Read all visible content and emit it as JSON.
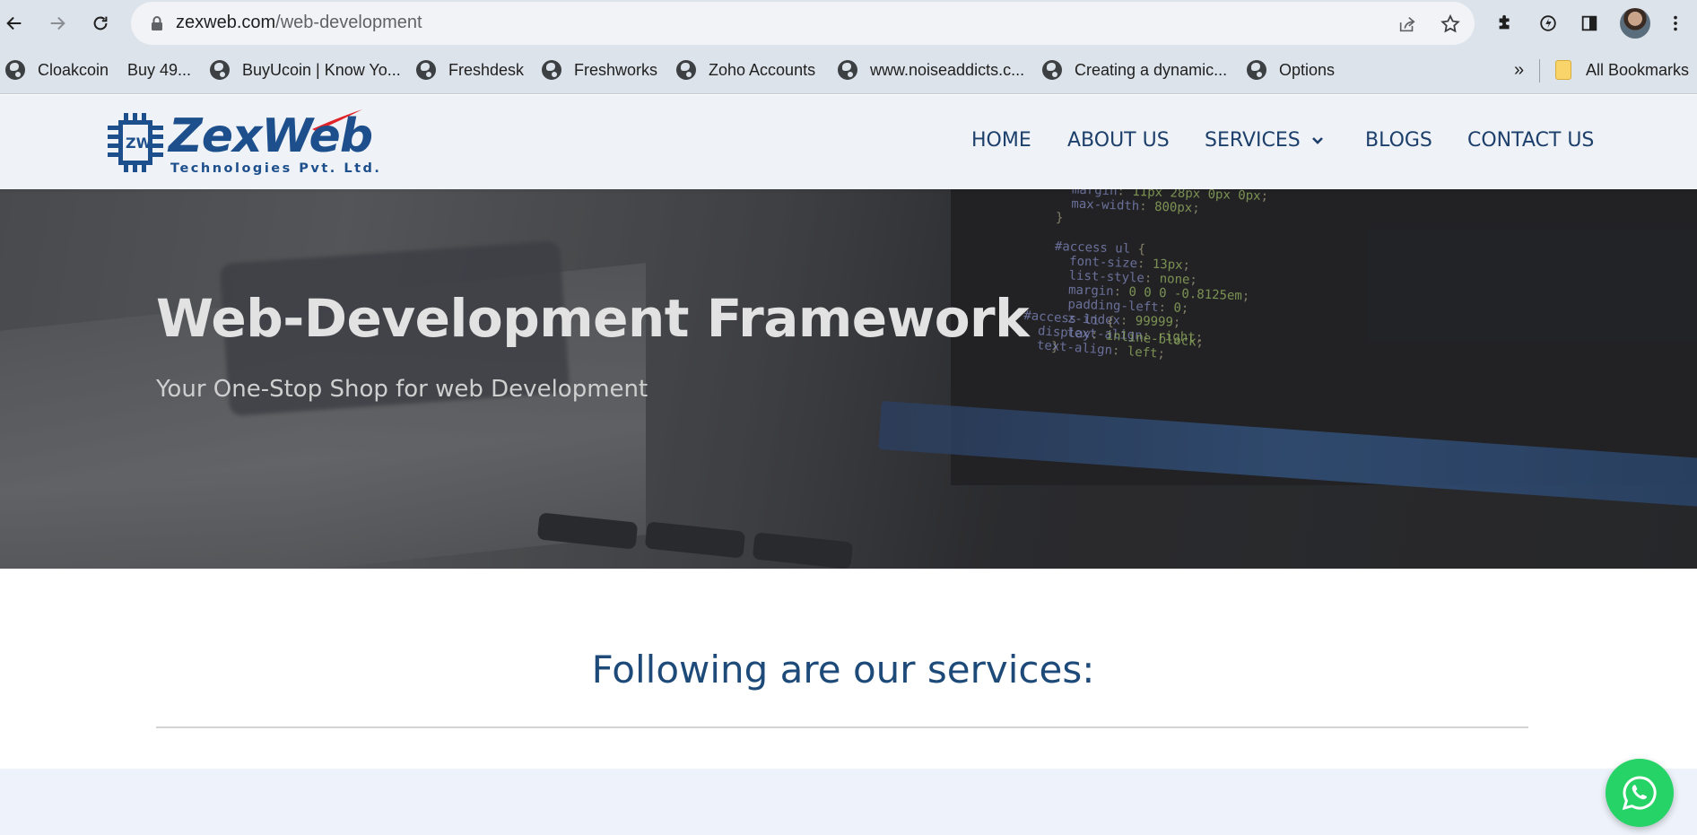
{
  "browser": {
    "url_host": "zexweb.com",
    "url_path": "/web-development",
    "bookmarks": [
      "Cloakcoin",
      "Buy 49...",
      "BuyUcoin | Know Yo...",
      "Freshdesk",
      "Freshworks",
      "Zoho Accounts",
      "www.noiseaddicts.c...",
      "Creating a dynamic...",
      "Options"
    ],
    "overflow": "»",
    "all_bookmarks": "All Bookmarks"
  },
  "site": {
    "logo_word": "ZexWeb",
    "logo_sub": "Technologies Pvt. Ltd.",
    "logo_mark": "ZW",
    "nav": [
      "HOME",
      "ABOUT US",
      "SERVICES",
      "BLOGS",
      "CONTACT US"
    ]
  },
  "hero": {
    "title": "Web-Development Framework",
    "subtitle": "Your One-Stop Shop for web Development"
  },
  "services": {
    "heading": "Following are our services:"
  },
  "colors": {
    "brand_blue": "#1d4f8c",
    "nav_text": "#1d3f6b",
    "whatsapp": "#25d366"
  }
}
